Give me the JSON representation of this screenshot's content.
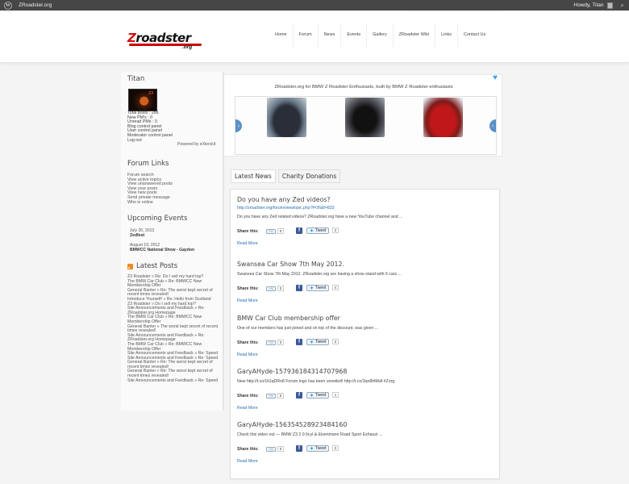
{
  "admin_bar": {
    "wp_glyph": "W",
    "site_name": "ZRoadster.org",
    "greeting": "Howdy, Titan",
    "search_icon": "⌕"
  },
  "logo": {
    "word_a": "Z",
    "word_b": "roadster",
    "subtitle": ".org"
  },
  "nav": [
    "Home",
    "Forum",
    "News",
    "Events",
    "Gallery",
    "ZRoadster Wiki",
    "Links",
    "Contact Us"
  ],
  "sidebar": {
    "user": {
      "name": "Titan",
      "avatar_text": "Z3",
      "stats": [
        "Total posts : 286",
        "New PM's : 0",
        "Unread PMs : 0",
        "Blog control panel",
        "User control panel",
        "Moderator control panel",
        "Log out"
      ],
      "powered": "Powered by eXtend.lt"
    },
    "forum_links": {
      "title": "Forum Links",
      "items": [
        "Forum search",
        "View active topics",
        "View unanswered posts",
        "View your posts",
        "View new posts",
        "Send private message",
        "Who is online"
      ]
    },
    "events": {
      "title": "Upcoming Events",
      "items": [
        {
          "date": "July 20, 2012",
          "title": "Zedfest"
        },
        {
          "date": "August 19, 2012",
          "title": "BMWCC National Show - Gaydon"
        }
      ]
    },
    "latest_posts": {
      "title": "Latest Posts",
      "items": [
        "Z3 Roadster » Re: Do I sell my hard top?",
        "The BMW Car Club » Re: BMWCC New Membership Offer",
        "General Banter » Re: The worst kept secret of recent times revealed!",
        "Introduce Yourself! » Re: Hello from Scotland",
        "Z3 Roadster » Do I sell my hard top?",
        "Site Announcements and Feedback » Re: ZRoadster.org Homepage",
        "The BMW Car Club » Re: BMWCC New Membership Offer",
        "General Banter » The worst kept secret of recent times revealed!",
        "Site Announcements and Feedback » Re: ZRoadster.org Homepage",
        "The BMW Car Club » Re: BMWCC New Membership Offer",
        "Site Announcements and Feedback » Re: Speed",
        "Site Announcements and Feedback » Re: Speed",
        "General Banter » Re: The worst kept secret of recent times revealed!",
        "General Banter » Re: The worst kept secret of recent times revealed!",
        "Site Announcements and Feedback » Re: Speed"
      ]
    }
  },
  "featured": {
    "title": "ZRoadster.org for BMW Z Roadster Enthusiasts, built by BMW Z Roadster enthusiasts",
    "heart_icon": "♥",
    "prev": "‹",
    "next": "›"
  },
  "tabs": [
    "Latest News",
    "Charity Donations"
  ],
  "share": {
    "label": "Share this:",
    "gplus": "+1",
    "facebook": "f",
    "tweet": "Tweet",
    "more": "Read More"
  },
  "articles": [
    {
      "title": "Do you have any Zed videos?",
      "url": "http://zroadster.org/forum/viewtopic.php?f=36&t=833",
      "excerpt": "Do you have any Zed related videos? ZRoadster.org have a new YouTube channel and ...",
      "gplus_count": "0",
      "tweet_count": "2"
    },
    {
      "title": "Swansea Car Show 7th May 2012.",
      "url": "",
      "excerpt": "Swansea Car Show 7th May 2012. ZRoadster.org are having a show stand with 6 cars ...",
      "gplus_count": "0",
      "tweet_count": "4"
    },
    {
      "title": "BMW Car Club membership offer",
      "url": "",
      "excerpt": "One of our members has just joined and on top of the discount, was given ...",
      "gplus_count": "0",
      "tweet_count": "2"
    },
    {
      "title": "GaryAHyde-157936184314707968",
      "url": "",
      "excerpt": "New http://t.co/Ut1qDRn8 Forum logo has been unveiled! http://t.co/3an8hMkA #Zorg",
      "gplus_count": "0",
      "tweet_count": "1"
    },
    {
      "title": "GaryAHyde-156354528923484160",
      "url": "",
      "excerpt": "Check this video out — BMW Z3 2.0 6cyl & Eisenmann Road Sport Exhaust ...",
      "gplus_count": "0",
      "tweet_count": "3"
    }
  ]
}
